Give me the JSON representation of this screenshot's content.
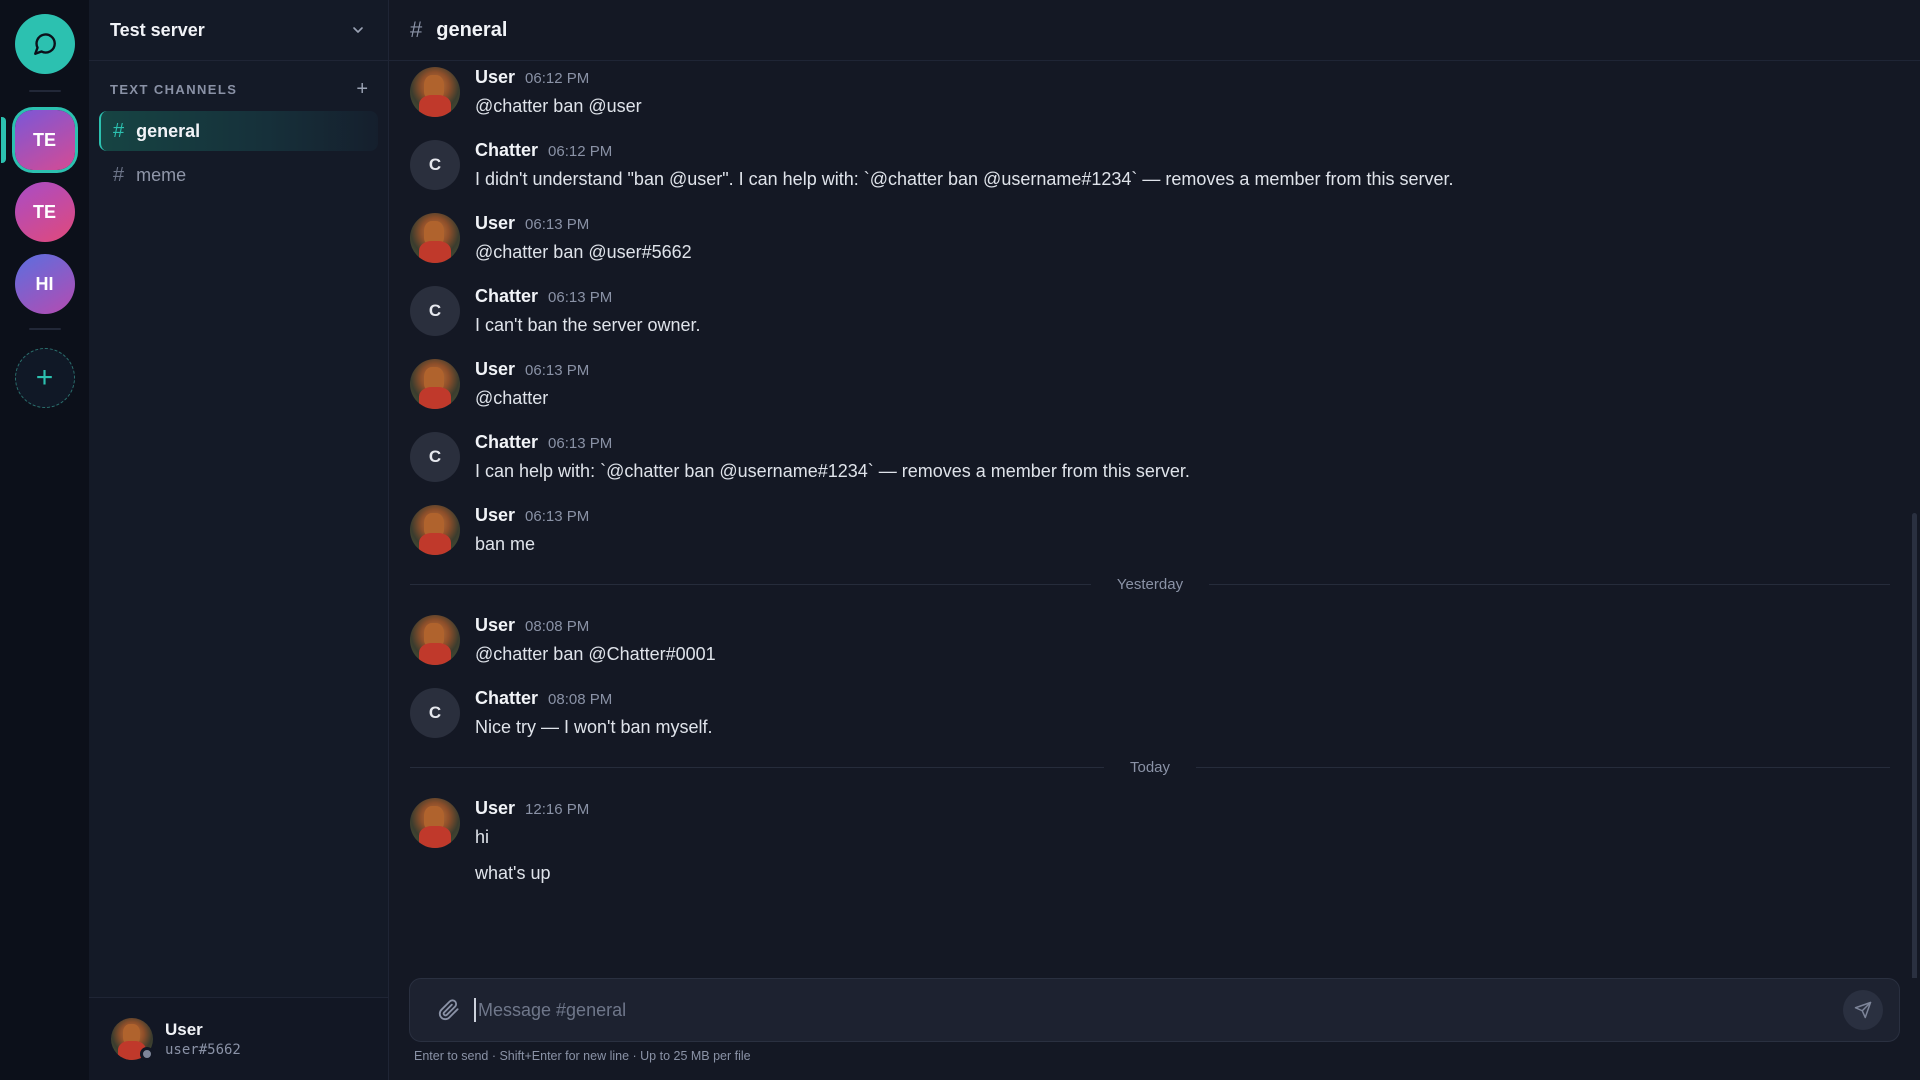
{
  "server": {
    "name": "Test server"
  },
  "rail": {
    "servers": [
      {
        "initials": "TE"
      },
      {
        "initials": "TE"
      },
      {
        "initials": "HI"
      }
    ]
  },
  "sidebar": {
    "section_title": "TEXT CHANNELS",
    "channels": [
      {
        "name": "general"
      },
      {
        "name": "meme"
      }
    ]
  },
  "current_user": {
    "name": "User",
    "tag": "user#5662"
  },
  "channel": {
    "name": "general"
  },
  "messages": [
    {
      "author": "User",
      "time": "06:12 PM",
      "text": "@chatter ban @user"
    },
    {
      "author": "Chatter",
      "avatar": "C",
      "time": "06:12 PM",
      "text": "I didn't understand \"ban @user\". I can help with: `@chatter ban @username#1234` — removes a member from this server."
    },
    {
      "author": "User",
      "time": "06:13 PM",
      "text": "@chatter ban @user#5662"
    },
    {
      "author": "Chatter",
      "avatar": "C",
      "time": "06:13 PM",
      "text": "I can't ban the server owner."
    },
    {
      "author": "User",
      "time": "06:13 PM",
      "text": "@chatter"
    },
    {
      "author": "Chatter",
      "avatar": "C",
      "time": "06:13 PM",
      "text": "I can help with: `@chatter ban @username#1234` — removes a member from this server."
    },
    {
      "author": "User",
      "time": "06:13 PM",
      "text": "ban me"
    },
    {
      "author": "User",
      "time": "08:08 PM",
      "text": "@chatter ban @Chatter#0001"
    },
    {
      "author": "Chatter",
      "avatar": "C",
      "time": "08:08 PM",
      "text": "Nice try — I won't ban myself."
    },
    {
      "author": "User",
      "time": "12:16 PM",
      "text": "hi",
      "text2": "what's up"
    }
  ],
  "dividers": {
    "yesterday": "Yesterday",
    "today": "Today"
  },
  "composer": {
    "placeholder": "Message #general",
    "hint": "Enter to send · Shift+Enter for new line · Up to 25 MB per file"
  },
  "colors": {
    "accent": "#2cc1b0",
    "background": "#141824",
    "sidebar": "#141a27",
    "rail": "#0c101a"
  }
}
